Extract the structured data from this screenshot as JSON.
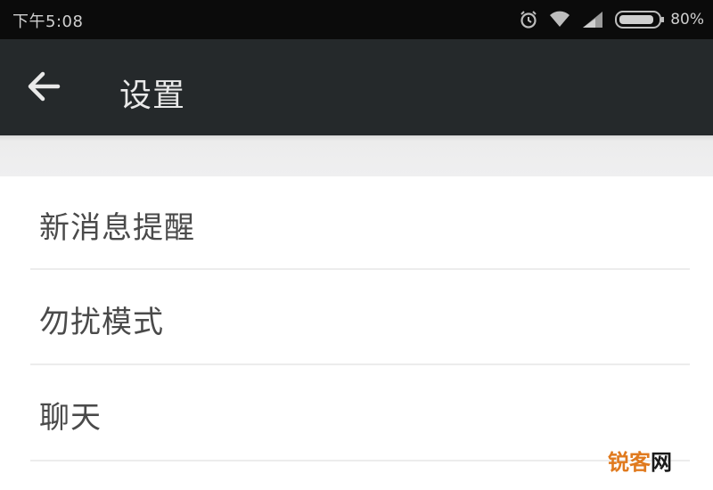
{
  "status_bar": {
    "time": "下午5:08",
    "battery_percent": "80%",
    "icons": [
      "alarm-icon",
      "wifi-icon",
      "signal-icon",
      "battery-icon"
    ]
  },
  "toolbar": {
    "back_icon": "arrow-left-icon",
    "title": "设置"
  },
  "settings": {
    "items": [
      {
        "label": "新消息提醒"
      },
      {
        "label": "勿扰模式"
      },
      {
        "label": "聊天"
      }
    ]
  },
  "watermark": {
    "part1": "锐客",
    "part2": "网"
  },
  "colors": {
    "status_bar_bg": "#0b0b0b",
    "toolbar_bg": "#25292b",
    "title_color": "#e9e9e9",
    "item_text": "#4a4a4a",
    "watermark_orange": "#e07a1e"
  }
}
